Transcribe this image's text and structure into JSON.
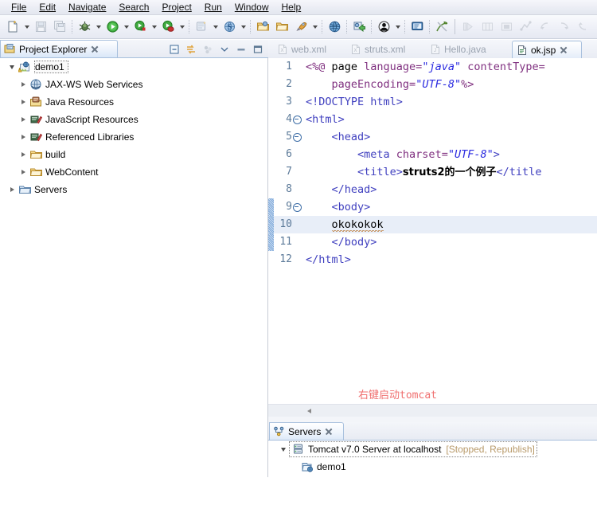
{
  "menubar": {
    "items": [
      {
        "label": "File",
        "name": "menu-file"
      },
      {
        "label": "Edit",
        "name": "menu-edit"
      },
      {
        "label": "Navigate",
        "name": "menu-navigate"
      },
      {
        "label": "Search",
        "name": "menu-search"
      },
      {
        "label": "Project",
        "name": "menu-project"
      },
      {
        "label": "Run",
        "name": "menu-run"
      },
      {
        "label": "Window",
        "name": "menu-window"
      },
      {
        "label": "Help",
        "name": "menu-help"
      }
    ]
  },
  "toolbar": {
    "icons": [
      "new-wizard-icon",
      "save-icon",
      "save-all-icon",
      "debug-icon",
      "run-icon",
      "run-external-tools-icon",
      "coverage-icon",
      "new-jsp-icon",
      "search-icon",
      "open-type-icon",
      "open-resource-icon",
      "external-tools-icon",
      "web-browser-icon",
      "deploy-icon",
      "user-icon",
      "console-icon",
      "pin-icon",
      "step-over-icon",
      "columns-icon",
      "terminate-icon",
      "next-annotation-icon",
      "previous-edit-icon",
      "forward-icon",
      "back-icon"
    ]
  },
  "project_explorer": {
    "tab_title": "Project Explorer",
    "tab_icon": "project-explorer-icon",
    "toolbar_icons": [
      "collapse-all-icon",
      "link-with-editor-icon",
      "view-menu-icon",
      "minimize-icon",
      "maximize-icon"
    ],
    "tree": [
      {
        "label": "demo1",
        "icon": "dynamic-web-project-icon",
        "depth": 0,
        "expanded": true,
        "warning": true
      },
      {
        "label": "JAX-WS Web Services",
        "icon": "jax-ws-icon",
        "depth": 1,
        "expanded": false
      },
      {
        "label": "Java Resources",
        "icon": "java-resources-icon",
        "depth": 1,
        "expanded": false
      },
      {
        "label": "JavaScript Resources",
        "icon": "javascript-resources-icon",
        "depth": 1,
        "expanded": false
      },
      {
        "label": "Referenced Libraries",
        "icon": "referenced-libraries-icon",
        "depth": 1,
        "expanded": false
      },
      {
        "label": "build",
        "icon": "folder-icon",
        "depth": 1,
        "expanded": false
      },
      {
        "label": "WebContent",
        "icon": "folder-icon",
        "depth": 1,
        "expanded": false
      },
      {
        "label": "Servers",
        "icon": "servers-folder-icon",
        "depth": 0,
        "expanded": false
      }
    ]
  },
  "editor": {
    "tabs": [
      {
        "label": "web.xml",
        "icon": "xml-file-icon",
        "active": false
      },
      {
        "label": "struts.xml",
        "icon": "xml-file-icon",
        "active": false
      },
      {
        "label": "Hello.java",
        "icon": "java-file-icon",
        "active": false
      },
      {
        "label": "ok.jsp",
        "icon": "jsp-file-icon",
        "active": true,
        "closeable": true
      }
    ],
    "lines": [
      {
        "num": "1",
        "fold": false,
        "changed": false,
        "highlight": false,
        "segments": [
          {
            "t": "<%@ ",
            "c": "k-jsp"
          },
          {
            "t": "page ",
            "c": "k-plain"
          },
          {
            "t": "language=",
            "c": "k-attr"
          },
          {
            "t": "\"java\"",
            "c": "k-str"
          },
          {
            "t": " contentType=",
            "c": "k-attr"
          }
        ]
      },
      {
        "num": "2",
        "fold": false,
        "changed": false,
        "highlight": false,
        "segments": [
          {
            "t": "    ",
            "c": "k-plain"
          },
          {
            "t": "pageEncoding=",
            "c": "k-attr"
          },
          {
            "t": "\"UTF-8\"",
            "c": "k-str"
          },
          {
            "t": "%>",
            "c": "k-jsp"
          }
        ]
      },
      {
        "num": "3",
        "fold": false,
        "changed": false,
        "highlight": false,
        "segments": [
          {
            "t": "<!DOCTYPE html>",
            "c": "k-doc"
          }
        ]
      },
      {
        "num": "4",
        "fold": true,
        "changed": false,
        "highlight": false,
        "segments": [
          {
            "t": "<html>",
            "c": "k-tag"
          }
        ]
      },
      {
        "num": "5",
        "fold": true,
        "changed": false,
        "highlight": false,
        "segments": [
          {
            "t": "    <head>",
            "c": "k-tag"
          }
        ]
      },
      {
        "num": "6",
        "fold": false,
        "changed": false,
        "highlight": false,
        "segments": [
          {
            "t": "        <meta ",
            "c": "k-tag"
          },
          {
            "t": "charset=",
            "c": "k-attr"
          },
          {
            "t": "\"UTF-8\"",
            "c": "k-str"
          },
          {
            "t": ">",
            "c": "k-tag"
          }
        ]
      },
      {
        "num": "7",
        "fold": false,
        "changed": false,
        "highlight": false,
        "segments": [
          {
            "t": "        <title>",
            "c": "k-tag"
          },
          {
            "t": "struts2的一个例子",
            "c": "cn"
          },
          {
            "t": "</title",
            "c": "k-tag"
          }
        ]
      },
      {
        "num": "8",
        "fold": false,
        "changed": false,
        "highlight": false,
        "segments": [
          {
            "t": "    </head>",
            "c": "k-tag"
          }
        ]
      },
      {
        "num": "9",
        "fold": true,
        "changed": true,
        "highlight": false,
        "segments": [
          {
            "t": "    <body>",
            "c": "k-tag"
          }
        ]
      },
      {
        "num": "10",
        "fold": false,
        "changed": true,
        "highlight": true,
        "segments": [
          {
            "t": "    ",
            "c": "k-plain"
          },
          {
            "t": "okokokok",
            "c": "k-plain squiggle"
          }
        ]
      },
      {
        "num": "11",
        "fold": false,
        "changed": true,
        "highlight": false,
        "segments": [
          {
            "t": "    </body>",
            "c": "k-tag"
          }
        ]
      },
      {
        "num": "12",
        "fold": false,
        "changed": false,
        "highlight": false,
        "segments": [
          {
            "t": "</html>",
            "c": "k-tag"
          }
        ]
      }
    ]
  },
  "annotation": {
    "text_cn": "右键启动",
    "text_en": "tomcat",
    "color": "#f07070",
    "arrow_color": "#f03c3c"
  },
  "servers_view": {
    "tab_title": "Servers",
    "tab_icon": "servers-view-icon",
    "rows": [
      {
        "label": "Tomcat v7.0 Server at localhost",
        "state": "[Stopped, Republish]",
        "icon": "server-icon",
        "depth": 0,
        "expanded": true,
        "selected": true
      },
      {
        "label": "demo1",
        "state": "",
        "icon": "module-icon",
        "depth": 1,
        "expanded": false,
        "selected": false
      }
    ]
  }
}
